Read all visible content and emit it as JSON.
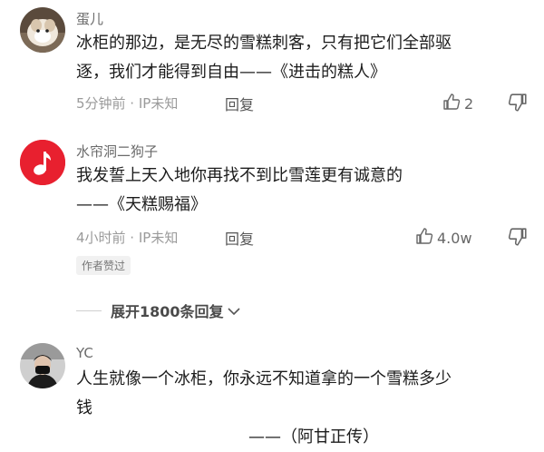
{
  "comments": [
    {
      "username": "蛋儿",
      "lines": [
        "冰柜的那边，是无尽的雪糕刺客，只有把它们全部驱",
        "逐，我们才能得到自由——《进击的糕人》"
      ],
      "meta": "5分钟前 · IP未知",
      "reply": "回复",
      "likes": "2",
      "avatar_icon": "cat-photo-avatar"
    },
    {
      "username": "水帘洞二狗子",
      "lines": [
        "我发誓上天入地你再找不到比雪莲更有诚意的",
        "——《天糕赐福》"
      ],
      "meta": "4小时前 · IP未知",
      "reply": "回复",
      "likes": "4.0w",
      "badge": "作者赞过",
      "avatar_icon": "music-note-avatar"
    },
    {
      "username": "YC",
      "lines": [
        "人生就像一个冰柜，你永远不知道拿的一个雪糕多少",
        "钱",
        "——（阿甘正传）"
      ],
      "avatar_icon": "person-photo-avatar"
    }
  ],
  "expand": {
    "label": "展开1800条回复"
  },
  "colors": {
    "music_red": "#e8202f",
    "text": "#1c1c1c",
    "meta": "#9a9a9a"
  }
}
